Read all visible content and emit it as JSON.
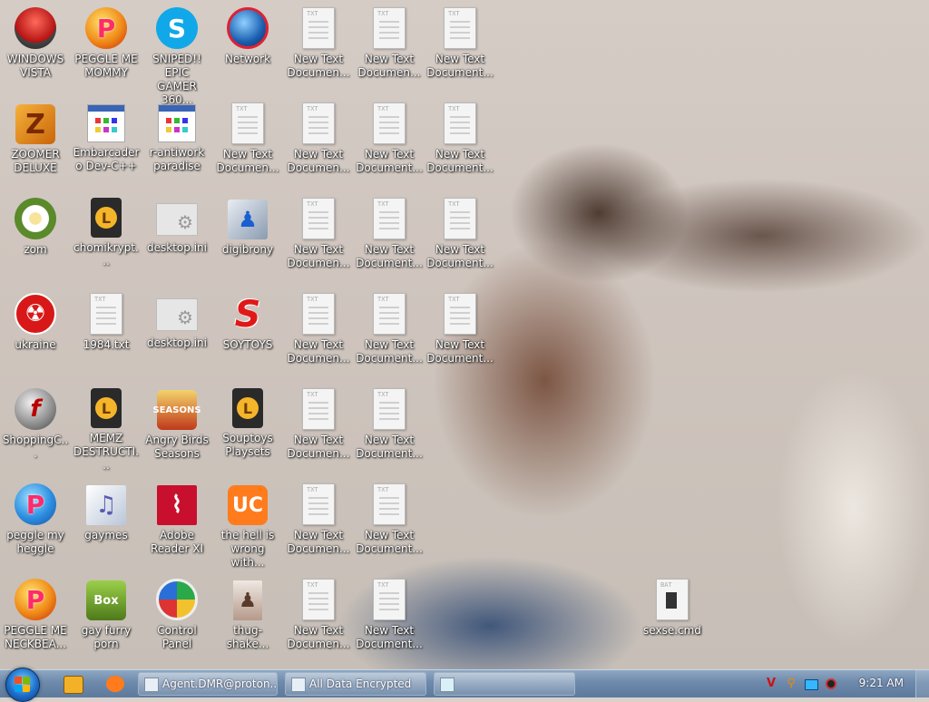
{
  "desktop_icons": [
    {
      "id": "windows-vista",
      "label": "WINDOWS VISTA",
      "type": "bowl"
    },
    {
      "id": "peggle-me-mommy",
      "label": "PEGGLE ME MOMMY",
      "type": "peggle"
    },
    {
      "id": "sniped-epic-gamer",
      "label": "SNIPED!! EPIC GAMER 360...",
      "type": "skype"
    },
    {
      "id": "network",
      "label": "Network",
      "type": "network"
    },
    {
      "id": "new-text-1",
      "label": "New Text Documen...",
      "type": "txt"
    },
    {
      "id": "new-text-2",
      "label": "New Text Documen...",
      "type": "txt"
    },
    {
      "id": "new-text-3",
      "label": "New Text Document...",
      "type": "txt"
    },
    {
      "id": "zoomer-deluxe",
      "label": "ZOOMER DELUXE",
      "type": "zoomer"
    },
    {
      "id": "embarcadero",
      "label": "Embarcadero Dev-C++",
      "type": "exe"
    },
    {
      "id": "r-antiwork",
      "label": "r-antiwork paradise",
      "type": "exe"
    },
    {
      "id": "new-text-4",
      "label": "New Text Documen...",
      "type": "txt"
    },
    {
      "id": "new-text-5",
      "label": "New Text Documen...",
      "type": "txt"
    },
    {
      "id": "new-text-6",
      "label": "New Text Document...",
      "type": "txt"
    },
    {
      "id": "new-text-7",
      "label": "New Text Document...",
      "type": "txt"
    },
    {
      "id": "zom",
      "label": "zom",
      "type": "flower"
    },
    {
      "id": "chomikrypt",
      "label": "chomikrypt...",
      "type": "wmp"
    },
    {
      "id": "desktop-ini-1",
      "label": "desktop.ini",
      "type": "ini"
    },
    {
      "id": "digibrony",
      "label": "digibrony",
      "type": "setup"
    },
    {
      "id": "new-text-8",
      "label": "New Text Documen...",
      "type": "txt"
    },
    {
      "id": "new-text-9",
      "label": "New Text Document...",
      "type": "txt"
    },
    {
      "id": "new-text-10",
      "label": "New Text Document...",
      "type": "txt"
    },
    {
      "id": "ukraine",
      "label": "ukraine",
      "type": "radiation"
    },
    {
      "id": "1984-txt",
      "label": "1984.txt",
      "type": "txt"
    },
    {
      "id": "desktop-ini-2",
      "label": "desktop.ini",
      "type": "ini"
    },
    {
      "id": "soytoys",
      "label": "SOYTOYS",
      "type": "soytoys"
    },
    {
      "id": "new-text-11",
      "label": "New Text Documen...",
      "type": "txt"
    },
    {
      "id": "new-text-12",
      "label": "New Text Document...",
      "type": "txt"
    },
    {
      "id": "new-text-13",
      "label": "New Text Document...",
      "type": "txt"
    },
    {
      "id": "shopping",
      "label": "ShoppingC...",
      "type": "flash"
    },
    {
      "id": "memz",
      "label": "MEMZ DESTRUCTI...",
      "type": "wmp"
    },
    {
      "id": "angry-birds",
      "label": "Angry Birds Seasons",
      "type": "angry"
    },
    {
      "id": "souptoys",
      "label": "Souptoys Playsets",
      "type": "wmp"
    },
    {
      "id": "new-text-14",
      "label": "New Text Documen...",
      "type": "txt"
    },
    {
      "id": "new-text-15",
      "label": "New Text Document...",
      "type": "txt"
    },
    {
      "id": "peggle-my-heggle",
      "label": "peggle my heggle",
      "type": "peggle2"
    },
    {
      "id": "gaymes",
      "label": "gaymes",
      "type": "folder"
    },
    {
      "id": "adobe-reader",
      "label": "Adobe Reader XI",
      "type": "adobe"
    },
    {
      "id": "the-hell",
      "label": "the hell is wrong with...",
      "type": "uc"
    },
    {
      "id": "new-text-16",
      "label": "New Text Documen...",
      "type": "txt"
    },
    {
      "id": "new-text-17",
      "label": "New Text Document...",
      "type": "txt"
    },
    {
      "id": "peggle-neckbeard",
      "label": "PEGGLE ME NECKBEA...",
      "type": "peggle"
    },
    {
      "id": "gay-furry-porn",
      "label": "gay furry porn",
      "type": "box"
    },
    {
      "id": "control-panel",
      "label": "Control Panel",
      "type": "control"
    },
    {
      "id": "thug-shake",
      "label": "thug-shake...",
      "type": "photo"
    },
    {
      "id": "new-text-18",
      "label": "New Text Documen...",
      "type": "txt"
    },
    {
      "id": "new-text-19",
      "label": "New Text Document...",
      "type": "txt"
    },
    {
      "id": "sexse-cmd",
      "label": "sexse.cmd",
      "type": "bat"
    }
  ],
  "taskbar": {
    "buttons": [
      {
        "label": "Agent.DMR@proton..."
      },
      {
        "label": "All Data Encrypted"
      },
      {
        "label": ""
      }
    ],
    "clock": "9:21 AM"
  },
  "colors": {
    "taskbar": "#6d89ab",
    "accent": "#1e6fcb"
  }
}
